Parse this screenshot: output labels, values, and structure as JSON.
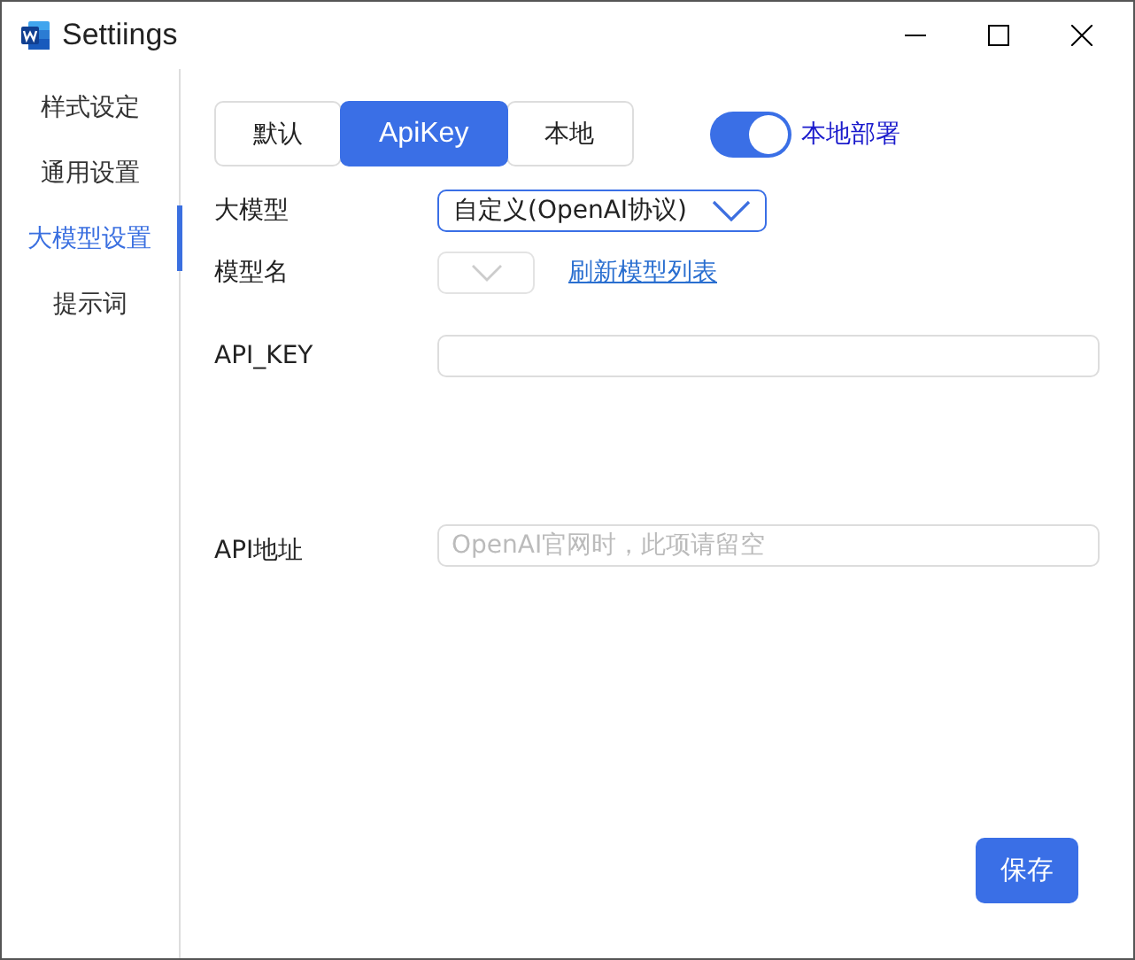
{
  "window": {
    "title": "Settiings"
  },
  "sidebar": {
    "items": [
      {
        "label": "样式设定",
        "selected": false
      },
      {
        "label": "通用设置",
        "selected": false
      },
      {
        "label": "大模型设置",
        "selected": true
      },
      {
        "label": "提示词",
        "selected": false
      }
    ]
  },
  "tabs": [
    {
      "label": "默认",
      "selected": false
    },
    {
      "label": "ApiKey",
      "selected": true
    },
    {
      "label": "本地",
      "selected": false
    }
  ],
  "local_deploy": {
    "label": "本地部署",
    "on": true
  },
  "model": {
    "label": "大模型",
    "value": "自定义(OpenAI协议)"
  },
  "model_name": {
    "label": "模型名",
    "link": "刷新模型列表"
  },
  "api_key": {
    "label": "API_KEY"
  },
  "api_url": {
    "label": "API地址",
    "placeholder": "OpenAI官网时，此项请留空"
  },
  "save_button": "保存"
}
